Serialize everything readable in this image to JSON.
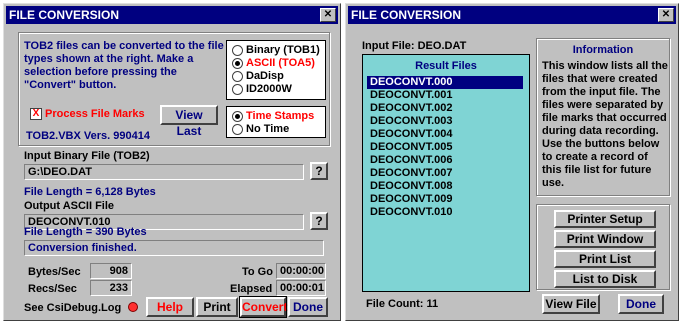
{
  "left": {
    "title": "FILE CONVERSION",
    "close": "✕",
    "description": "TOB2 files can be converted to the file types shown at the right. Make a selection before pressing the \"Convert\" button.",
    "formats": [
      {
        "label": "Binary (TOB1)",
        "selected": false
      },
      {
        "label": "ASCII (TOA5)",
        "selected": true
      },
      {
        "label": "DaDisp",
        "selected": false
      },
      {
        "label": "ID2000W",
        "selected": false
      }
    ],
    "process_marks": {
      "label": "Process File Marks",
      "checked": true,
      "check": "X"
    },
    "view_last": "View Last",
    "time_options": [
      {
        "label": "Time Stamps",
        "selected": true
      },
      {
        "label": "No Time",
        "selected": false
      }
    ],
    "version": "TOB2.VBX Vers. 990414",
    "input_label": "Input Binary File (TOB2)",
    "input_value": "G:\\DEO.DAT",
    "browse_label": "?",
    "input_length": "File Length = 6,128 Bytes",
    "output_label": "Output ASCII File",
    "output_value": "DEOCONVT.010",
    "output_length": "File Length = 390 Bytes",
    "status": "Conversion finished.",
    "bytes_sec_label": "Bytes/Sec",
    "bytes_sec_value": "908",
    "recs_sec_label": "Recs/Sec",
    "recs_sec_value": "233",
    "togo_label": "To Go",
    "togo_value": "00:00:00",
    "elapsed_label": "Elapsed",
    "elapsed_value": "00:00:01",
    "debug_label": "See CsiDebug.Log",
    "buttons": {
      "help": "Help",
      "print": "Print",
      "convert": "Convert",
      "done": "Done"
    }
  },
  "right": {
    "title": "FILE CONVERSION",
    "close": "✕",
    "input_file": "Input File: DEO.DAT",
    "results_header": "Result Files",
    "results": [
      "DEOCONVT.000",
      "DEOCONVT.001",
      "DEOCONVT.002",
      "DEOCONVT.003",
      "DEOCONVT.004",
      "DEOCONVT.005",
      "DEOCONVT.006",
      "DEOCONVT.007",
      "DEOCONVT.008",
      "DEOCONVT.009",
      "DEOCONVT.010"
    ],
    "selected_index": 0,
    "file_count": "File Count: 11",
    "info_header": "Information",
    "info_text": "This window lists all the files that were created from the input file. The files were separated by file marks that occurred during data recording. Use the buttons below to create a record of this file list for future use.",
    "buttons": {
      "printer_setup": "Printer Setup",
      "print_window": "Print Window",
      "print_list": "Print List",
      "list_to_disk": "List to Disk",
      "view_file": "View File",
      "done": "Done"
    }
  },
  "colors": {
    "titlebar": "#000080",
    "face": "#c0c0c0",
    "list_bg": "#7fd4d4",
    "accent_red": "#ff0000",
    "accent_blue": "#000080"
  }
}
